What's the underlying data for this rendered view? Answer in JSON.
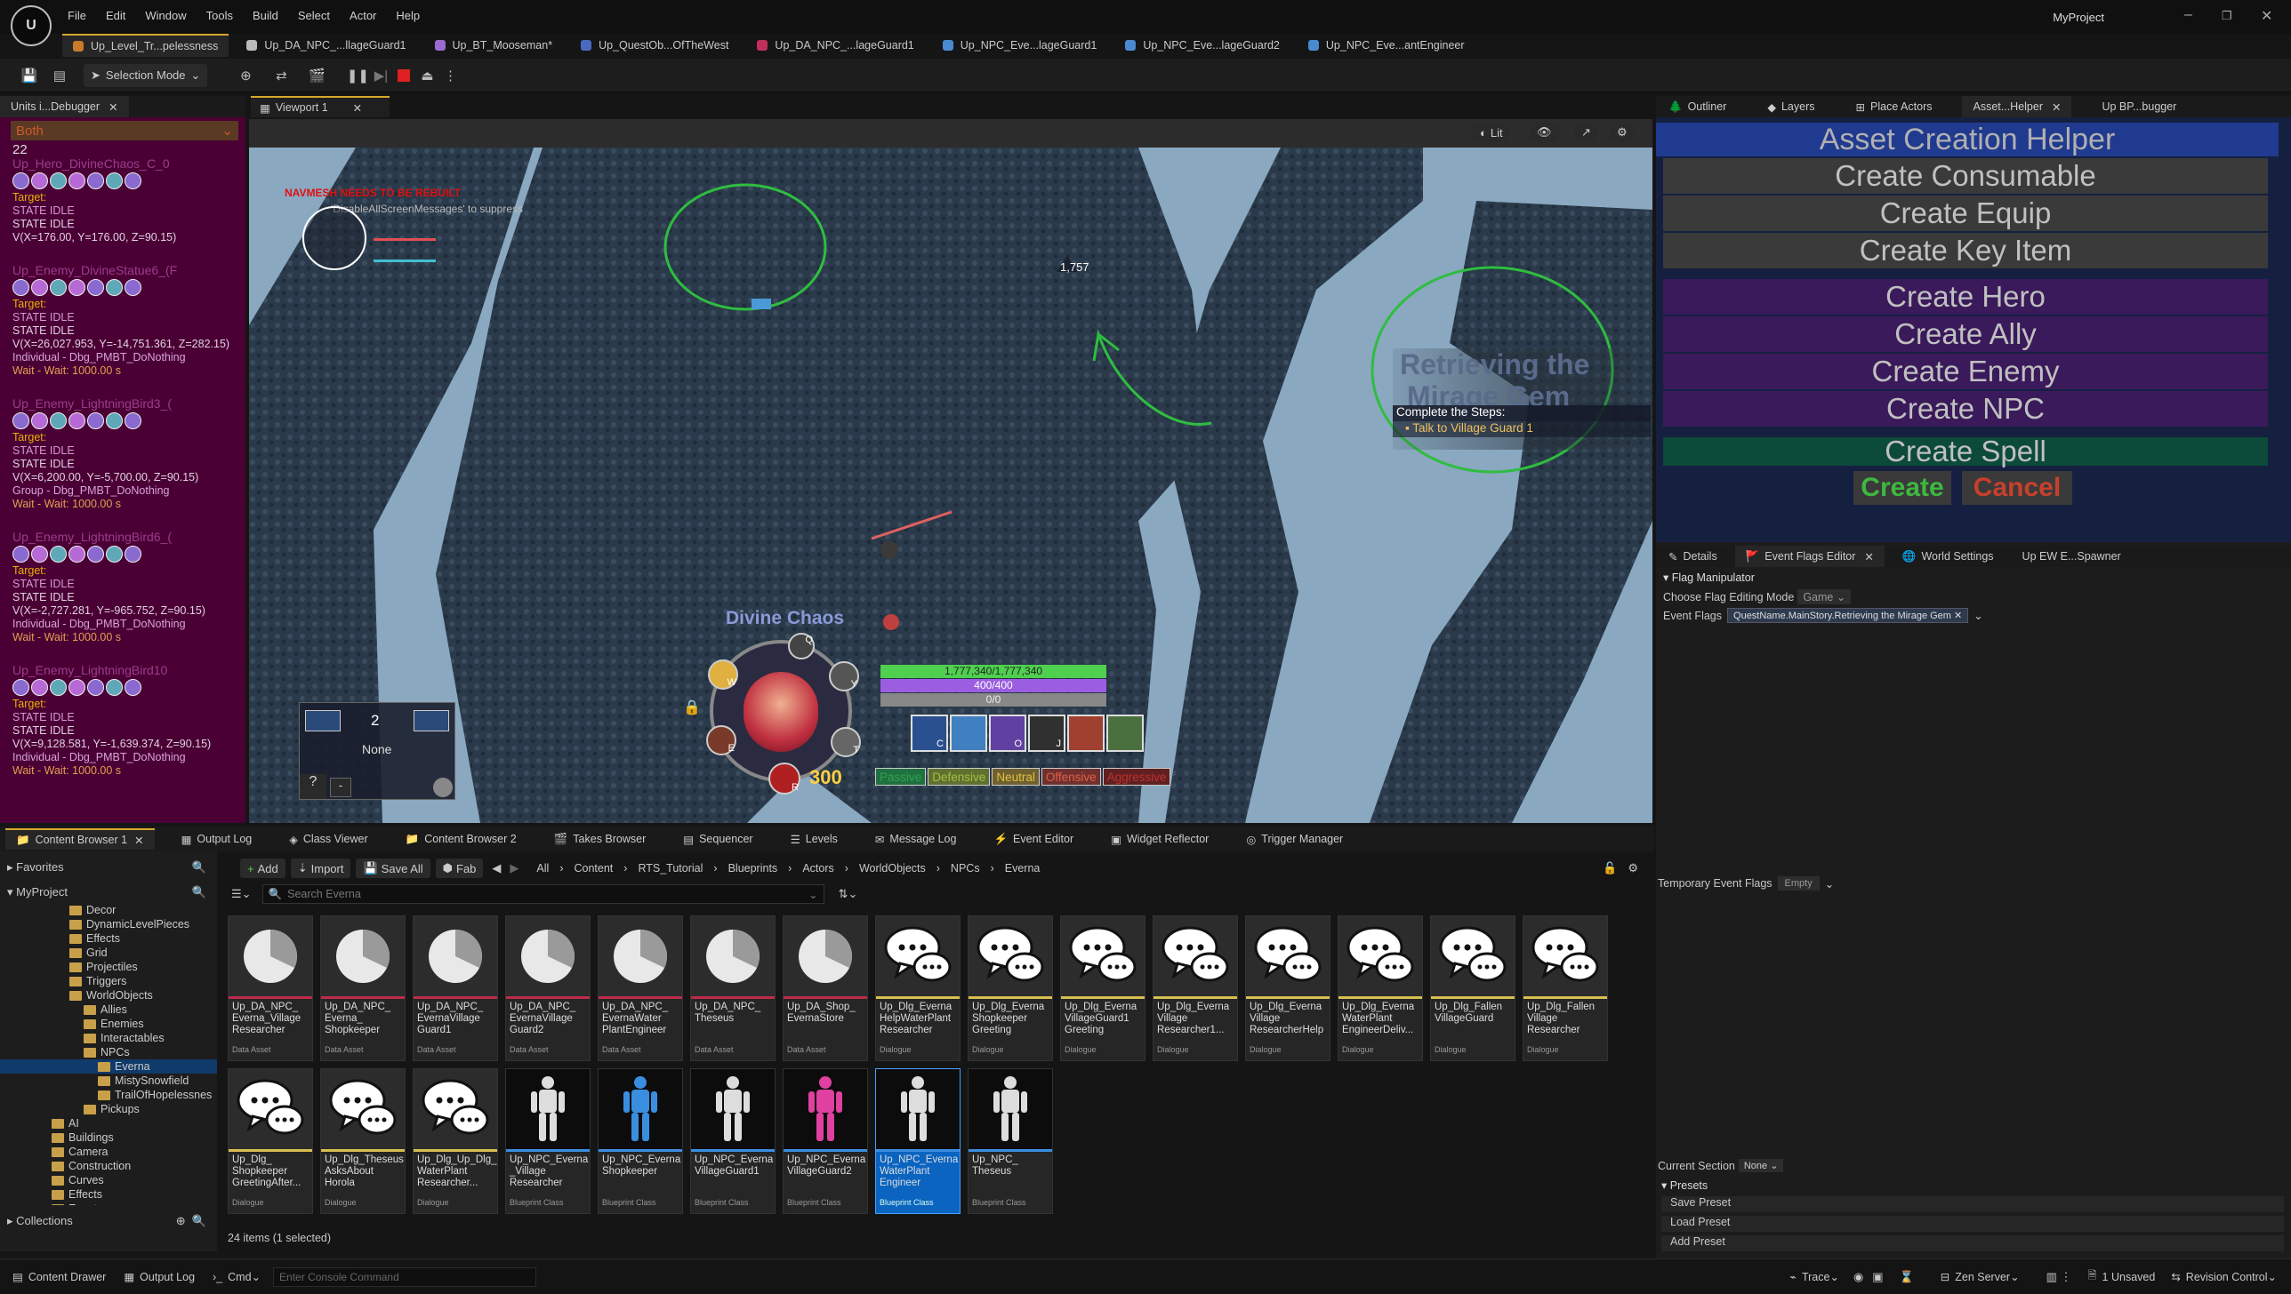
{
  "app": {
    "project": "MyProject"
  },
  "menu": [
    "File",
    "Edit",
    "Window",
    "Tools",
    "Build",
    "Select",
    "Actor",
    "Help"
  ],
  "doc_tabs": [
    {
      "label": "Up_Level_Tr...pelessness",
      "color": "#c77b2b",
      "active": true
    },
    {
      "label": "Up_DA_NPC_...llageGuard1",
      "color": "#bbbbbb"
    },
    {
      "label": "Up_BT_Mooseman*",
      "color": "#9a6ad0"
    },
    {
      "label": "Up_QuestOb...OfTheWest",
      "color": "#4a6ac0"
    },
    {
      "label": "Up_DA_NPC_...lageGuard1",
      "color": "#c0305a"
    },
    {
      "label": "Up_NPC_Eve...lageGuard1",
      "color": "#4a8ad0"
    },
    {
      "label": "Up_NPC_Eve...lageGuard2",
      "color": "#4a8ad0"
    },
    {
      "label": "Up_NPC_Eve...antEngineer",
      "color": "#4a8ad0"
    }
  ],
  "toolbar": {
    "selection_mode": "Selection Mode"
  },
  "debugger": {
    "tab": "Units i...Debugger",
    "filter": "Both",
    "count": "22",
    "units": [
      {
        "name": "Up_Hero_DivineChaos_C_0",
        "target": "Target:",
        "state1": "STATE IDLE",
        "state2": "STATE IDLE",
        "pos": "V(X=176.00, Y=176.00, Z=90.15)",
        "behavior": "",
        "wait": ""
      },
      {
        "name": "Up_Enemy_DivineStatue6_(F",
        "target": "Target:",
        "state1": "STATE IDLE",
        "state2": "STATE IDLE",
        "pos": "V(X=26,027.953, Y=-14,751.361, Z=282.15)",
        "behavior": "Individual - Dbg_PMBT_DoNothing",
        "wait": "Wait - Wait: 1000.00 s"
      },
      {
        "name": "Up_Enemy_LightningBird3_(",
        "target": "Target:",
        "state1": "STATE IDLE",
        "state2": "STATE IDLE",
        "pos": "V(X=6,200.00, Y=-5,700.00, Z=90.15)",
        "behavior": "Group - Dbg_PMBT_DoNothing",
        "wait": "Wait - Wait: 1000.00 s"
      },
      {
        "name": "Up_Enemy_LightningBird6_(",
        "target": "Target:",
        "state1": "STATE IDLE",
        "state2": "STATE IDLE",
        "pos": "V(X=-2,727.281, Y=-965.752, Z=90.15)",
        "behavior": "Individual - Dbg_PMBT_DoNothing",
        "wait": "Wait - Wait: 1000.00 s"
      },
      {
        "name": "Up_Enemy_LightningBird10",
        "target": "Target:",
        "state1": "STATE IDLE",
        "state2": "STATE IDLE",
        "pos": "V(X=9,128.581, Y=-1,639.374, Z=90.15)",
        "behavior": "Individual - Dbg_PMBT_DoNothing",
        "wait": "Wait - Wait: 1000.00 s"
      }
    ]
  },
  "viewport": {
    "tab": "Viewport 1",
    "lit": "Lit",
    "navmesh_warning": "NAVMESH NEEDS TO BE REBUILT",
    "suppress_msg": "'DisableAllScreenMessages' to suppress",
    "enemy_label": "1,757",
    "quest_title_1": "Retrieving the",
    "quest_title_2": "Mirage Gem",
    "quest_steps": "Complete the Steps:",
    "quest_step1": "Talk to Village Guard 1",
    "hero_name": "Divine Chaos",
    "hp": "1,777,340/1,777,340",
    "mp": "400/400",
    "xp": "0/0",
    "gold": "300",
    "hotkeys": {
      "q": "Q",
      "w": "W",
      "e": "E",
      "r": "R",
      "t": "T",
      "y": "Y"
    },
    "ability_keys": [
      "C",
      "",
      "O",
      "J",
      "",
      ""
    ],
    "stances": [
      "Passive",
      "Defensive",
      "Neutral",
      "Offensive",
      "Aggressive"
    ],
    "group_count": "2",
    "group_label": "None",
    "help": "?",
    "minus": "-"
  },
  "right_tabs": [
    "Outliner",
    "Layers",
    "Place Actors",
    "Asset...Helper",
    "Up BP...bugger"
  ],
  "asset_helper": {
    "title": "Asset Creation Helper",
    "buttons": [
      "Create Consumable",
      "Create Equip",
      "Create Key Item",
      "Create Hero",
      "Create Ally",
      "Create Enemy",
      "Create NPC",
      "Create Spell"
    ],
    "create": "Create",
    "cancel": "Cancel"
  },
  "details_tabs": [
    "Details",
    "Event Flags Editor",
    "World Settings",
    "Up EW E...Spawner"
  ],
  "flags": {
    "section": "Flag Manipulator",
    "mode_label": "Choose Flag Editing Mode",
    "mode_value": "Game",
    "event_flags_label": "Event Flags",
    "event_flag": "QuestName.MainStory.Retrieving the Mirage Gem",
    "temp_label": "Temporary Event Flags",
    "temp_value": "Empty",
    "current_section_label": "Current Section",
    "current_section_value": "None",
    "presets": "Presets",
    "save_preset": "Save Preset",
    "load_preset": "Load Preset",
    "add_preset": "Add Preset"
  },
  "bottom_tabs": [
    "Content Browser 1",
    "Output Log",
    "Class Viewer",
    "Content Browser 2",
    "Takes Browser",
    "Sequencer",
    "Levels",
    "Message Log",
    "Event Editor",
    "Widget Reflector",
    "Trigger Manager"
  ],
  "cb": {
    "add": "Add",
    "import": "Import",
    "save_all": "Save All",
    "fab": "Fab",
    "breadcrumb": [
      "All",
      "Content",
      "RTS_Tutorial",
      "Blueprints",
      "Actors",
      "WorldObjects",
      "NPCs",
      "Everna"
    ],
    "search_placeholder": "Search Everna",
    "favorites": "Favorites",
    "myproject": "MyProject",
    "collections": "Collections",
    "items_count": "24 items (1 selected)",
    "tree": [
      {
        "label": "Decor",
        "indent": 0
      },
      {
        "label": "DynamicLevelPieces",
        "indent": 0
      },
      {
        "label": "Effects",
        "indent": 0
      },
      {
        "label": "Grid",
        "indent": 0
      },
      {
        "label": "Projectiles",
        "indent": 0
      },
      {
        "label": "Triggers",
        "indent": 0
      },
      {
        "label": "WorldObjects",
        "indent": 0
      },
      {
        "label": "Allies",
        "indent": 1
      },
      {
        "label": "Enemies",
        "indent": 1
      },
      {
        "label": "Interactables",
        "indent": 1
      },
      {
        "label": "NPCs",
        "indent": 1
      },
      {
        "label": "Everna",
        "indent": 2,
        "selected": true
      },
      {
        "label": "MistySnowfield",
        "indent": 2
      },
      {
        "label": "TrailOfHopelessnes",
        "indent": 2
      },
      {
        "label": "Pickups",
        "indent": 1
      },
      {
        "label": "AI",
        "indent": -1
      },
      {
        "label": "Buildings",
        "indent": -1
      },
      {
        "label": "Camera",
        "indent": -1
      },
      {
        "label": "Construction",
        "indent": -1
      },
      {
        "label": "Curves",
        "indent": -1
      },
      {
        "label": "Effects",
        "indent": -1
      },
      {
        "label": "Events",
        "indent": -1
      }
    ],
    "assets": [
      {
        "name": "Up_DA_NPC_ Everna_Village Researcher",
        "type": "Data Asset",
        "kind": "pie"
      },
      {
        "name": "Up_DA_NPC_ Everna_ Shopkeeper",
        "type": "Data Asset",
        "kind": "pie"
      },
      {
        "name": "Up_DA_NPC_ EvernaVillage Guard1",
        "type": "Data Asset",
        "kind": "pie"
      },
      {
        "name": "Up_DA_NPC_ EvernaVillage Guard2",
        "type": "Data Asset",
        "kind": "pie"
      },
      {
        "name": "Up_DA_NPC_ EvernaWater PlantEngineer",
        "type": "Data Asset",
        "kind": "pie"
      },
      {
        "name": "Up_DA_NPC_ Theseus",
        "type": "Data Asset",
        "kind": "pie"
      },
      {
        "name": "Up_DA_Shop_ EvernaStore",
        "type": "Data Asset",
        "kind": "pie"
      },
      {
        "name": "Up_Dlg_Everna HelpWaterPlant Researcher",
        "type": "Dialogue",
        "kind": "dlg"
      },
      {
        "name": "Up_Dlg_Everna Shopkeeper Greeting",
        "type": "Dialogue",
        "kind": "dlg"
      },
      {
        "name": "Up_Dlg_Everna VillageGuard1 Greeting",
        "type": "Dialogue",
        "kind": "dlg"
      },
      {
        "name": "Up_Dlg_Everna Village Researcher1...",
        "type": "Dialogue",
        "kind": "dlg"
      },
      {
        "name": "Up_Dlg_Everna Village ResearcherHelp",
        "type": "Dialogue",
        "kind": "dlg"
      },
      {
        "name": "Up_Dlg_Everna WaterPlant EngineerDeliv...",
        "type": "Dialogue",
        "kind": "dlg"
      },
      {
        "name": "Up_Dlg_Fallen VillageGuard",
        "type": "Dialogue",
        "kind": "dlg"
      },
      {
        "name": "Up_Dlg_Fallen Village Researcher",
        "type": "Dialogue",
        "kind": "dlg"
      },
      {
        "name": "Up_Dlg_ Shopkeeper GreetingAfter...",
        "type": "Dialogue",
        "kind": "dlg"
      },
      {
        "name": "Up_Dlg_Theseus AsksAbout Horola",
        "type": "Dialogue",
        "kind": "dlg"
      },
      {
        "name": "Up_Dlg_Up_Dlg_ WaterPlant Researcher...",
        "type": "Dialogue",
        "kind": "dlg"
      },
      {
        "name": "Up_NPC_Everna _Village Researcher",
        "type": "Blueprint Class",
        "kind": "bp",
        "color": "#dddddd"
      },
      {
        "name": "Up_NPC_Everna Shopkeeper",
        "type": "Blueprint Class",
        "kind": "bp",
        "color": "#3a8ee0"
      },
      {
        "name": "Up_NPC_Everna VillageGuard1",
        "type": "Blueprint Class",
        "kind": "bp",
        "color": "#dddddd"
      },
      {
        "name": "Up_NPC_Everna VillageGuard2",
        "type": "Blueprint Class",
        "kind": "bp",
        "color": "#e040a0"
      },
      {
        "name": "Up_NPC_Everna WaterPlant Engineer",
        "type": "Blueprint Class",
        "kind": "bp",
        "color": "#dddddd",
        "selected": true
      },
      {
        "name": "Up_NPC_ Theseus",
        "type": "Blueprint Class",
        "kind": "bp",
        "color": "#dddddd"
      }
    ]
  },
  "status": {
    "content_drawer": "Content Drawer",
    "output_log": "Output Log",
    "cmd": "Cmd",
    "console_placeholder": "Enter Console Command",
    "trace": "Trace",
    "zen": "Zen Server",
    "unsaved": "1 Unsaved",
    "revision": "Revision Control"
  },
  "colors": {
    "accent": "#d8a82c",
    "debug_bg": "#4b0035",
    "selection": "#0a64c0",
    "hp": "#4fd04f",
    "mp": "#9b5ee0"
  }
}
